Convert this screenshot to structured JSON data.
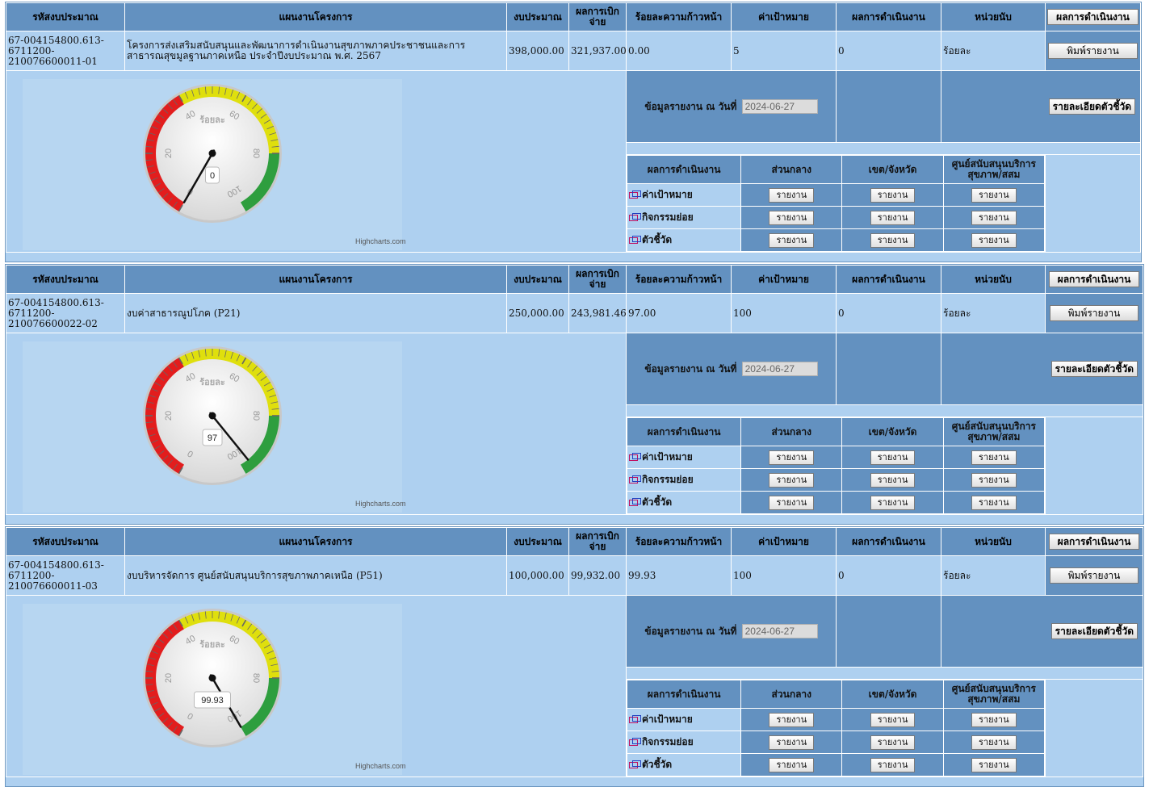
{
  "headers": {
    "budget_code": "รหัสงบประมาณ",
    "plan": "แผนงานโครงการ",
    "budget": "งบประมาณ",
    "disbursed": "ผลการเบิกจ่าย",
    "progress_pct": "ร้อยละความก้าวหน้า",
    "target": "ค่าเป้าหมาย",
    "result": "ผลการดำเนินงาน",
    "unit": "หน่วยนับ",
    "result_button": "ผลการดำเนินงาน"
  },
  "labels": {
    "print_button": "พิมพ์รายงาน",
    "report_date_label": "ข้อมูลรายงาน ณ วันที่",
    "detail_button": "รายละเอียดตัวชี้วัด",
    "sub_result": "ผลการดำเนินงาน",
    "sub_central": "ส่วนกลาง",
    "sub_region": "เขต/จังหวัด",
    "sub_center": "ศูนย์สนับสนุนบริการสุขภาพ/สสม",
    "row_target": "ค่าเป้าหมาย",
    "row_activity": "กิจกรรมย่อย",
    "row_indicator": "ตัวชี้วัด",
    "report_button": "รายงาน",
    "gauge_unit": "ร้อยละ",
    "credit": "Highcharts.com"
  },
  "gauge_ticks": [
    "0",
    "20",
    "40",
    "60",
    "80",
    "100"
  ],
  "gauge_colors": {
    "red": "#e21d1d",
    "yellow": "#dfdf0d",
    "green": "#2e9e3e"
  },
  "projects": [
    {
      "code": "67-004154800.613-6711200-210076600011-01",
      "plan": "โครงการส่งเสริมสนับสนุนและพัฒนาการดำเนินงานสุขภาพภาคประชาชนและการสาธารณสุขมูลฐานภาคเหนือ ประจำปีงบประมาณ พ.ศ. 2567",
      "budget": "398,000.00",
      "disbursed": "321,937.00",
      "progress": "0.00",
      "target": "5",
      "result": "0",
      "unit": "ร้อยละ",
      "report_date": "2024-06-27",
      "gauge_value": 0,
      "gauge_label": "0"
    },
    {
      "code": "67-004154800.613-6711200-210076600022-02",
      "plan": "งบค่าสาธารณูปโภค (P21)",
      "budget": "250,000.00",
      "disbursed": "243,981.46",
      "progress": "97.00",
      "target": "100",
      "result": "0",
      "unit": "ร้อยละ",
      "report_date": "2024-06-27",
      "gauge_value": 97,
      "gauge_label": "97"
    },
    {
      "code": "67-004154800.613-6711200-210076600011-03",
      "plan": "งบบริหารจัดการ ศูนย์สนับสนุนบริการสุขภาพภาคเหนือ (P51)",
      "budget": "100,000.00",
      "disbursed": "99,932.00",
      "progress": "99.93",
      "target": "100",
      "result": "0",
      "unit": "ร้อยละ",
      "report_date": "2024-06-27",
      "gauge_value": 99.93,
      "gauge_label": "99.93"
    }
  ]
}
